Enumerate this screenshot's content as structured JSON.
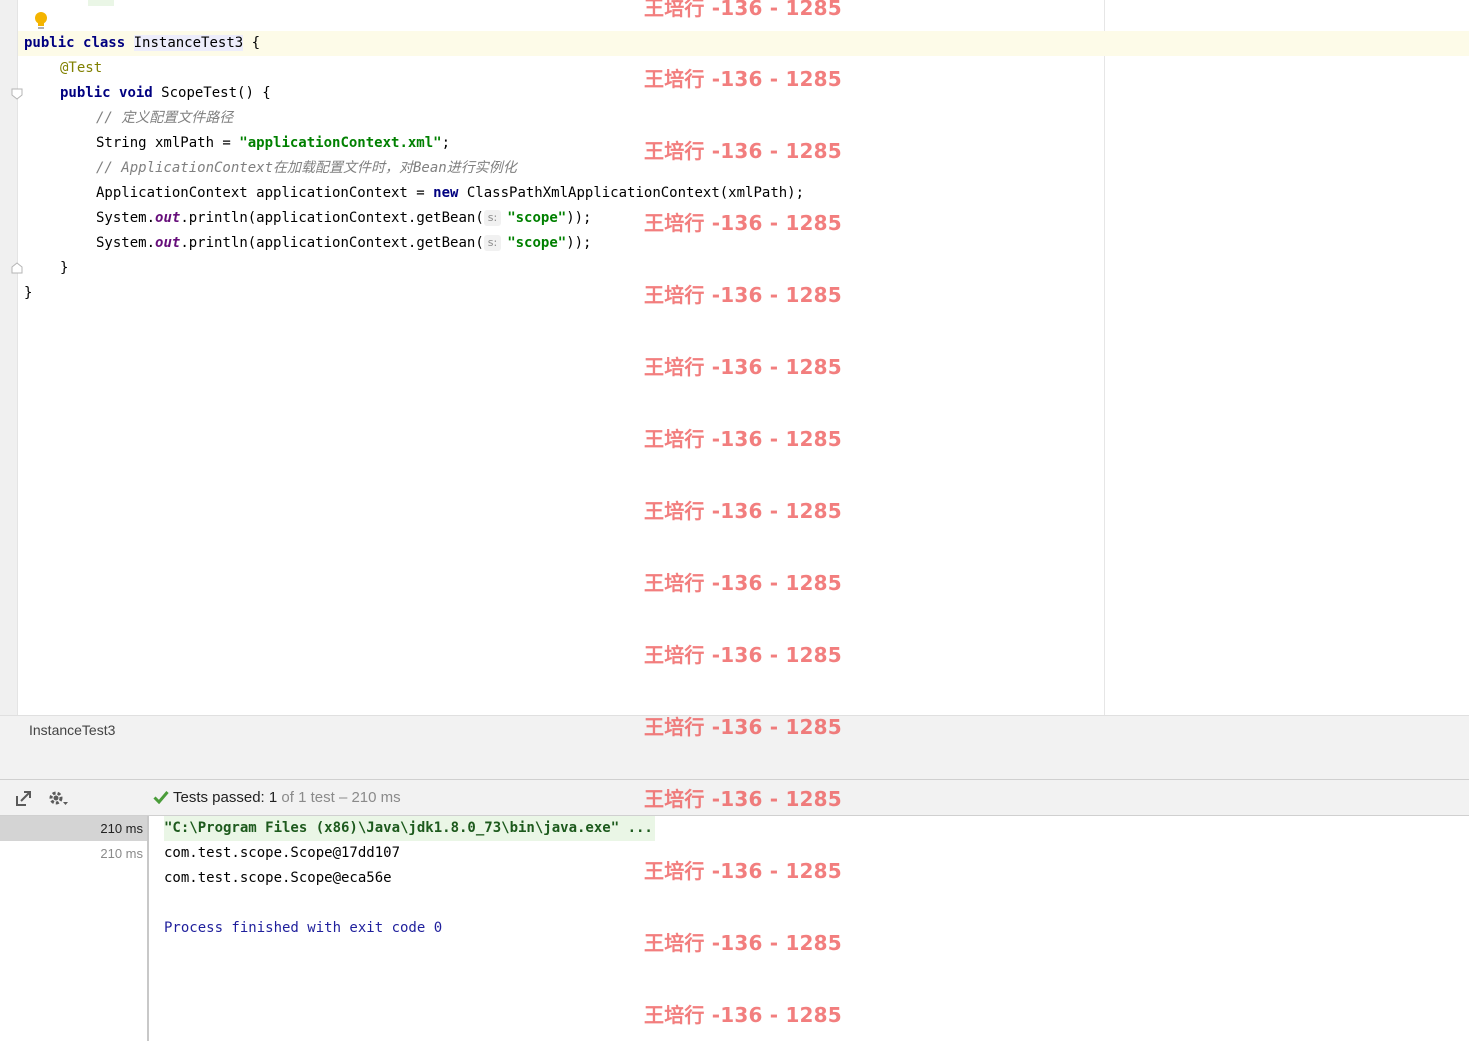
{
  "editor": {
    "lines": [
      [
        "public",
        " ",
        "class",
        " ",
        "InstanceTest3",
        " {"
      ],
      [
        "@Test"
      ],
      [
        "public",
        " ",
        "void",
        " ScopeTest() {"
      ],
      [
        "// 定义配置文件路径"
      ],
      [
        "String xmlPath = ",
        "\"applicationContext.xml\"",
        ";"
      ],
      [
        "// ApplicationContext在加载配置文件时，对Bean进行实例化"
      ],
      [
        "ApplicationContext applicationContext = ",
        "new",
        " ClassPathXmlApplicationContext(xmlPath);"
      ],
      [
        "System.",
        "out",
        ".println(applicationContext.getBean(",
        "s:",
        "\"scope\"",
        "));"
      ],
      [
        "System.",
        "out",
        ".println(applicationContext.getBean(",
        "s:",
        "\"scope\"",
        "));"
      ],
      [
        "}"
      ],
      [
        "}"
      ]
    ]
  },
  "breadcrumb": {
    "label": "InstanceTest3"
  },
  "run_toolbar": {
    "status_prefix": "Tests passed:",
    "status_count": "1",
    "status_rest": "of 1 test – 210 ms"
  },
  "test_tree": {
    "rows": [
      "210 ms",
      "210 ms"
    ]
  },
  "console": {
    "lines": [
      "\"C:\\Program Files (x86)\\Java\\jdk1.8.0_73\\bin\\java.exe\" ...",
      "com.test.scope.Scope@17dd107",
      "com.test.scope.Scope@eca56e",
      "Process finished with exit code 0"
    ]
  },
  "watermark": {
    "text": "王培行 -136 - 1285"
  },
  "colors": {
    "keyword": "#000080",
    "annotation": "#808000",
    "comment": "#808080",
    "string": "#008000",
    "field": "#660e7a",
    "pass_green": "#4a9c3a",
    "watermark": "#ee5a5a"
  }
}
